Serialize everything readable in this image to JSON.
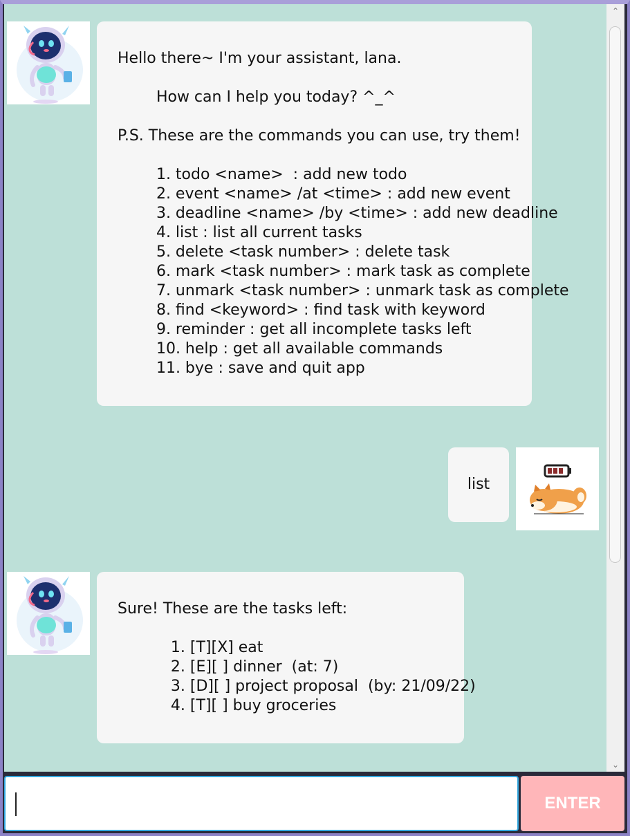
{
  "conversation": {
    "messages": [
      {
        "sender": "bot",
        "avatar": "robot-assistant-avatar",
        "lines": [
          "Hello there~ I'm your assistant, lana.",
          "",
          "        How can I help you today? ^_^",
          "",
          "P.S. These are the commands you can use, try them!",
          "",
          "        1. todo <name>  : add new todo",
          "        2. event <name> /at <time> : add new event",
          "        3. deadline <name> /by <time> : add new deadline",
          "        4. list : list all current tasks",
          "        5. delete <task number> : delete task",
          "        6. mark <task number> : mark task as complete",
          "        7. unmark <task number> : unmark task as complete",
          "        8. find <keyword> : find task with keyword",
          "        9. reminder : get all incomplete tasks left",
          "        10. help : get all available commands",
          "        11. bye : save and quit app"
        ]
      },
      {
        "sender": "user",
        "avatar": "sleeping-shiba-avatar",
        "lines": [
          "list"
        ]
      },
      {
        "sender": "bot",
        "avatar": "robot-assistant-avatar",
        "lines": [
          "Sure! These are the tasks left:",
          "",
          "           1. [T][X] eat",
          "           2. [E][ ] dinner  (at: 7)",
          "           3. [D][ ] project proposal  (by: 21/09/22)",
          "           4. [T][ ] buy groceries"
        ]
      }
    ]
  },
  "input": {
    "value": "",
    "placeholder": ""
  },
  "enter_button": {
    "label": "ENTER"
  },
  "colors": {
    "chat_background": "#bde0d8",
    "bubble": "#f6f6f6",
    "enter_button": "#ffb6b9",
    "input_focus_border": "#35a9e0",
    "window_border": "#a99fd9"
  }
}
